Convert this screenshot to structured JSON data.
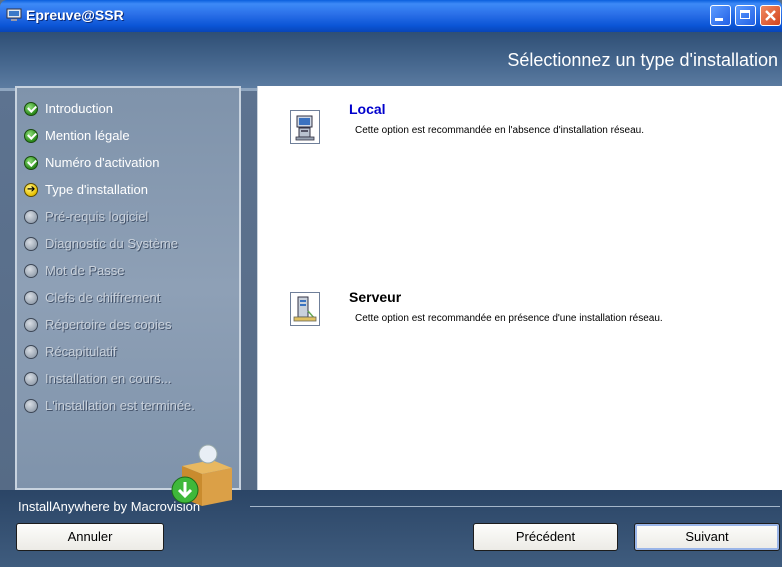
{
  "window": {
    "title": "Epreuve@SSR"
  },
  "header": {
    "title": "Sélectionnez un type d'installation"
  },
  "steps": [
    {
      "label": "Introduction",
      "state": "done"
    },
    {
      "label": "Mention légale",
      "state": "done"
    },
    {
      "label": "Numéro d'activation",
      "state": "done"
    },
    {
      "label": "Type d'installation",
      "state": "current"
    },
    {
      "label": "Pré-requis logiciel",
      "state": "todo"
    },
    {
      "label": "Diagnostic du Système",
      "state": "todo"
    },
    {
      "label": "Mot de Passe",
      "state": "todo"
    },
    {
      "label": "Clefs de chiffrement",
      "state": "todo"
    },
    {
      "label": "Répertoire des copies",
      "state": "todo"
    },
    {
      "label": "Récapitulatif",
      "state": "todo"
    },
    {
      "label": "Installation en cours...",
      "state": "todo"
    },
    {
      "label": "L'installation est terminée.",
      "state": "todo"
    }
  ],
  "options": [
    {
      "title": "Local",
      "description": "Cette option est recommandée en l'absence d'installation réseau.",
      "icon": "computer-icon"
    },
    {
      "title": "Serveur",
      "description": "Cette option est recommandée en présence d'une installation réseau.",
      "icon": "server-icon"
    }
  ],
  "footer": {
    "brand": "InstallAnywhere by Macrovision",
    "cancel_label": "Annuler",
    "previous_label": "Précédent",
    "next_label": "Suivant"
  }
}
